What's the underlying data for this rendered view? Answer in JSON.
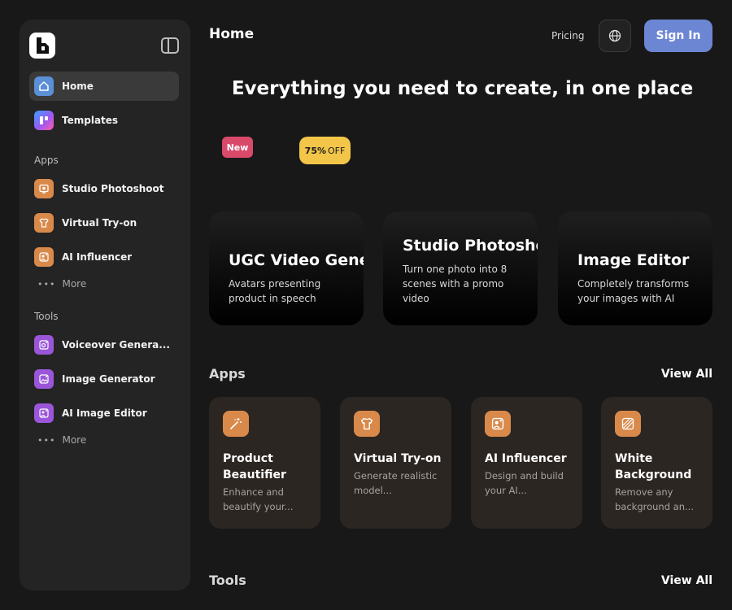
{
  "sidebar": {
    "nav": [
      {
        "label": "Home",
        "icon": "home-icon"
      },
      {
        "label": "Templates",
        "icon": "templates-icon"
      }
    ],
    "apps_label": "Apps",
    "apps": [
      {
        "label": "Studio Photoshoot",
        "icon": "photoshoot-icon"
      },
      {
        "label": "Virtual Try-on",
        "icon": "shirt-icon"
      },
      {
        "label": "AI Influencer",
        "icon": "influencer-icon"
      }
    ],
    "more_label": "More",
    "tools_label": "Tools",
    "tools": [
      {
        "label": "Voiceover Genera...",
        "icon": "voiceover-icon"
      },
      {
        "label": "Image Generator",
        "icon": "image-generator-icon"
      },
      {
        "label": "AI Image Editor",
        "icon": "image-editor-icon"
      }
    ]
  },
  "header": {
    "title": "Home",
    "pricing": "Pricing",
    "sign_in": "Sign In"
  },
  "hero": {
    "heading": "Everything you need to create, in one place",
    "badge_new": "New",
    "badge_discount_bold": "75%",
    "badge_discount_rest": "OFF"
  },
  "features": [
    {
      "title": "UGC Video Gene",
      "desc": [
        "Avatars presenting",
        "product in speech"
      ]
    },
    {
      "title": "Studio Photosho",
      "desc": [
        "Turn one photo into 8",
        "scenes with a promo",
        "video"
      ]
    },
    {
      "title": "Image Editor",
      "desc": [
        "Completely transforms",
        "your images with AI"
      ]
    }
  ],
  "apps_section": {
    "heading": "Apps",
    "view_all": "View All",
    "cards": [
      {
        "title": "Product Beautifier",
        "desc": "Enhance and beautify your...",
        "icon": "magic-wand-icon"
      },
      {
        "title": "Virtual Try-on",
        "desc": "Generate realistic model...",
        "icon": "shirt-icon"
      },
      {
        "title": "AI Influencer",
        "desc": "Design and build your AI...",
        "icon": "influencer-icon"
      },
      {
        "title": "White Background",
        "desc": "Remove any background an...",
        "icon": "background-pattern-icon"
      }
    ]
  },
  "tools_section": {
    "heading": "Tools",
    "view_all": "View All"
  },
  "colors": {
    "background": "#181818",
    "sidebar": "#242424",
    "accent": "#6c86d4",
    "app_card": "#2c2622",
    "orange_icon": "#d9894a",
    "purple_icon": "#9a55d9",
    "badge_new": "#d94a6a",
    "badge_discount": "#f3c64a"
  }
}
